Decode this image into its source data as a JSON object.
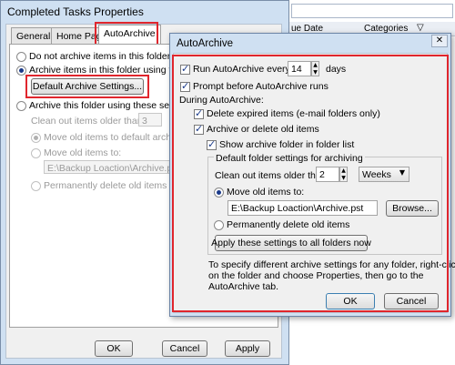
{
  "back_dialog": {
    "title": "Completed Tasks Properties",
    "tabs": [
      "General",
      "Home Page",
      "AutoArchive"
    ],
    "opt_do_not_archive": "Do not archive items in this folder",
    "opt_archive_default": "Archive items in this folder using the de",
    "default_settings_button": "Default Archive Settings...",
    "opt_archive_custom": "Archive this folder using these settings",
    "clean_out_label": "Clean out items older than",
    "clean_out_value": "3",
    "opt_move_default": "Move old items to default archive f",
    "opt_move_to": "Move old items to:",
    "move_path": "E:\\Backup Loaction\\Archive.pst",
    "opt_permanently_delete": "Permanently delete old items",
    "ok": "OK",
    "cancel": "Cancel",
    "apply": "Apply"
  },
  "outlook_strip": {
    "column_due_date": "ue Date",
    "column_categories": "Categories"
  },
  "autoarchive": {
    "title": "AutoArchive",
    "run_every_label": "Run AutoArchive every",
    "run_every_value": "14",
    "days": "days",
    "prompt_label": "Prompt before AutoArchive runs",
    "during_label": "During AutoArchive:",
    "delete_expired": "Delete expired items (e-mail folders only)",
    "archive_or_delete": "Archive or delete old items",
    "show_folder": "Show archive folder in folder list",
    "default_folder_settings": "Default folder settings for archiving",
    "clean_out_label": "Clean out items older than",
    "clean_out_value": "2",
    "clean_out_unit": "Weeks",
    "move_label": "Move old items to:",
    "move_path": "E:\\Backup Loaction\\Archive.pst",
    "browse": "Browse...",
    "permanently_delete": "Permanently delete old items",
    "apply_all": "Apply these settings to all folders now",
    "info_line1": "To specify different archive settings for any folder, right-click",
    "info_line2": "on the folder and choose Properties, then go to the",
    "info_line3": "AutoArchive tab.",
    "ok": "OK",
    "cancel": "Cancel"
  },
  "colors": {
    "highlight": "#e0262d",
    "title_bar": "#cfe0f2"
  }
}
